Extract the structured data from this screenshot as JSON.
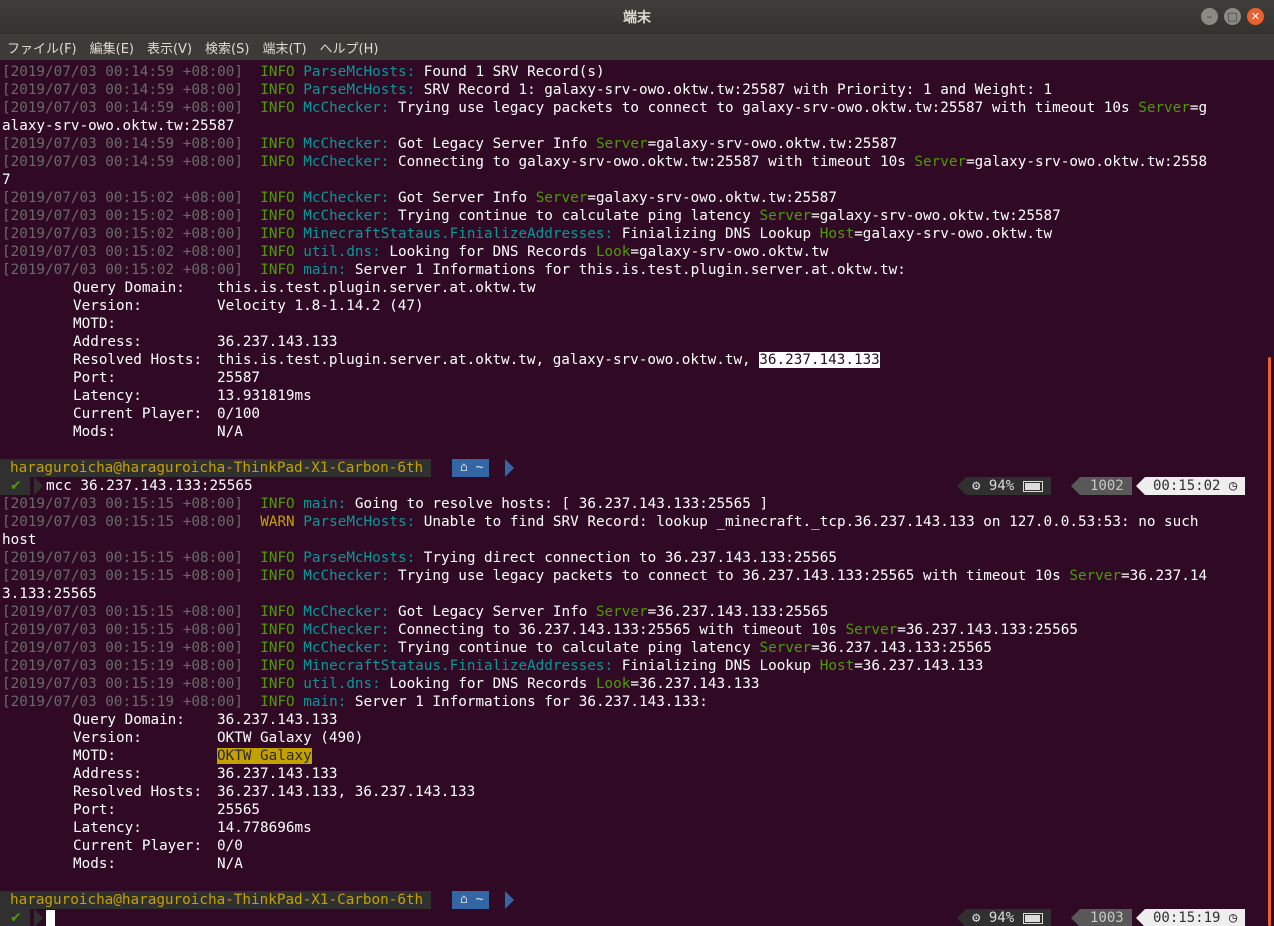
{
  "window": {
    "title": "端末"
  },
  "menubar": {
    "items": [
      "ファイル(F)",
      "編集(E)",
      "表示(V)",
      "検索(S)",
      "端末(T)",
      "ヘルプ(H)"
    ]
  },
  "log1": [
    {
      "ts": "[2019/07/03 00:14:59 +08:00]",
      "level": "INFO",
      "module": "ParseMcHosts:",
      "msg": " Found 1 SRV Record(s)",
      "key": "",
      "val": ""
    },
    {
      "ts": "[2019/07/03 00:14:59 +08:00]",
      "level": "INFO",
      "module": "ParseMcHosts:",
      "msg": " SRV Record 1: galaxy-srv-owo.oktw.tw:25587 with Priority: 1 and Weight: 1",
      "key": "",
      "val": ""
    },
    {
      "ts": "[2019/07/03 00:14:59 +08:00]",
      "level": "INFO",
      "module": "McChecker:",
      "msg": " Trying use legacy packets to connect to galaxy-srv-owo.oktw.tw:25587 with timeout 10s ",
      "key": "Server",
      "val": "=g"
    },
    {
      "cont": "alaxy-srv-owo.oktw.tw:25587"
    },
    {
      "ts": "[2019/07/03 00:14:59 +08:00]",
      "level": "INFO",
      "module": "McChecker:",
      "msg": " Got Legacy Server Info ",
      "key": "Server",
      "val": "=galaxy-srv-owo.oktw.tw:25587"
    },
    {
      "ts": "[2019/07/03 00:14:59 +08:00]",
      "level": "INFO",
      "module": "McChecker:",
      "msg": " Connecting to galaxy-srv-owo.oktw.tw:25587 with timeout 10s ",
      "key": "Server",
      "val": "=galaxy-srv-owo.oktw.tw:2558"
    },
    {
      "cont": "7"
    },
    {
      "ts": "[2019/07/03 00:15:02 +08:00]",
      "level": "INFO",
      "module": "McChecker:",
      "msg": " Got Server Info ",
      "key": "Server",
      "val": "=galaxy-srv-owo.oktw.tw:25587"
    },
    {
      "ts": "[2019/07/03 00:15:02 +08:00]",
      "level": "INFO",
      "module": "McChecker:",
      "msg": " Trying continue to calculate ping latency ",
      "key": "Server",
      "val": "=galaxy-srv-owo.oktw.tw:25587"
    },
    {
      "ts": "[2019/07/03 00:15:02 +08:00]",
      "level": "INFO",
      "module": "MinecraftStataus.FinializeAddresses:",
      "msg": " Finializing DNS Lookup ",
      "key": "Host",
      "val": "=galaxy-srv-owo.oktw.tw"
    },
    {
      "ts": "[2019/07/03 00:15:02 +08:00]",
      "level": "INFO",
      "module": "util.dns:",
      "msg": " Looking for DNS Records ",
      "key": "Look",
      "val": "=galaxy-srv-owo.oktw.tw"
    },
    {
      "ts": "[2019/07/03 00:15:02 +08:00]",
      "level": "INFO",
      "module": "main:",
      "msg": " Server 1 Informations for this.is.test.plugin.server.at.oktw.tw:",
      "key": "",
      "val": ""
    }
  ],
  "info1": [
    {
      "label": "Query Domain:",
      "value": "this.is.test.plugin.server.at.oktw.tw"
    },
    {
      "label": "Version:",
      "value": "Velocity 1.8-1.14.2 (47)"
    },
    {
      "label": "MOTD:",
      "value": ""
    },
    {
      "label": "Address:",
      "value": "36.237.143.133"
    },
    {
      "label": "Resolved Hosts:",
      "value": "this.is.test.plugin.server.at.oktw.tw, galaxy-srv-owo.oktw.tw, ",
      "selected": "36.237.143.133"
    },
    {
      "label": "Port:",
      "value": "25587"
    },
    {
      "label": "Latency:",
      "value": "13.931819ms"
    },
    {
      "label": "Current Player:",
      "value": "0/100"
    },
    {
      "label": "Mods:",
      "value": "N/A"
    }
  ],
  "prompt": {
    "user": "haraguroicha@haraguroicha-ThinkPad-X1-Carbon-6th",
    "dir": "~",
    "ok": "✔"
  },
  "command1": "mcc 36.237.143.133:25565",
  "status1": {
    "battery": "94%",
    "history": "1002",
    "time": "00:15:02"
  },
  "log2": [
    {
      "ts": "[2019/07/03 00:15:15 +08:00]",
      "level": "INFO",
      "module": "main:",
      "msg": " Going to resolve hosts: [ 36.237.143.133:25565 ]",
      "key": "",
      "val": ""
    },
    {
      "ts": "[2019/07/03 00:15:15 +08:00]",
      "level": "WARN",
      "module": "ParseMcHosts:",
      "msg": " Unable to find SRV Record: lookup _minecraft._tcp.36.237.143.133 on 127.0.0.53:53: no such",
      "key": "",
      "val": ""
    },
    {
      "cont": "host"
    },
    {
      "ts": "[2019/07/03 00:15:15 +08:00]",
      "level": "INFO",
      "module": "ParseMcHosts:",
      "msg": " Trying direct connection to 36.237.143.133:25565",
      "key": "",
      "val": ""
    },
    {
      "ts": "[2019/07/03 00:15:15 +08:00]",
      "level": "INFO",
      "module": "McChecker:",
      "msg": " Trying use legacy packets to connect to 36.237.143.133:25565 with timeout 10s ",
      "key": "Server",
      "val": "=36.237.14"
    },
    {
      "cont": "3.133:25565"
    },
    {
      "ts": "[2019/07/03 00:15:15 +08:00]",
      "level": "INFO",
      "module": "McChecker:",
      "msg": " Got Legacy Server Info ",
      "key": "Server",
      "val": "=36.237.143.133:25565"
    },
    {
      "ts": "[2019/07/03 00:15:15 +08:00]",
      "level": "INFO",
      "module": "McChecker:",
      "msg": " Connecting to 36.237.143.133:25565 with timeout 10s ",
      "key": "Server",
      "val": "=36.237.143.133:25565"
    },
    {
      "ts": "[2019/07/03 00:15:19 +08:00]",
      "level": "INFO",
      "module": "McChecker:",
      "msg": " Trying continue to calculate ping latency ",
      "key": "Server",
      "val": "=36.237.143.133:25565"
    },
    {
      "ts": "[2019/07/03 00:15:19 +08:00]",
      "level": "INFO",
      "module": "MinecraftStataus.FinializeAddresses:",
      "msg": " Finializing DNS Lookup ",
      "key": "Host",
      "val": "=36.237.143.133"
    },
    {
      "ts": "[2019/07/03 00:15:19 +08:00]",
      "level": "INFO",
      "module": "util.dns:",
      "msg": " Looking for DNS Records ",
      "key": "Look",
      "val": "=36.237.143.133"
    },
    {
      "ts": "[2019/07/03 00:15:19 +08:00]",
      "level": "INFO",
      "module": "main:",
      "msg": " Server 1 Informations for 36.237.143.133:",
      "key": "",
      "val": ""
    }
  ],
  "info2": [
    {
      "label": "Query Domain:",
      "value": "36.237.143.133"
    },
    {
      "label": "Version:",
      "value": "OKTW Galaxy (490)"
    },
    {
      "label": "MOTD:",
      "value": "",
      "highlight": "OKTW Galaxy"
    },
    {
      "label": "Address:",
      "value": "36.237.143.133"
    },
    {
      "label": "Resolved Hosts:",
      "value": "36.237.143.133, 36.237.143.133"
    },
    {
      "label": "Port:",
      "value": "25565"
    },
    {
      "label": "Latency:",
      "value": "14.778696ms"
    },
    {
      "label": "Current Player:",
      "value": "0/0"
    },
    {
      "label": "Mods:",
      "value": "N/A"
    }
  ],
  "status2": {
    "battery": "94%",
    "history": "1003",
    "time": "00:15:19"
  },
  "colors": {
    "background": "#300a24",
    "info": "#4e9a06",
    "warn": "#c4a000",
    "module": "#06989a",
    "timestamp": "#6a6a6a"
  }
}
